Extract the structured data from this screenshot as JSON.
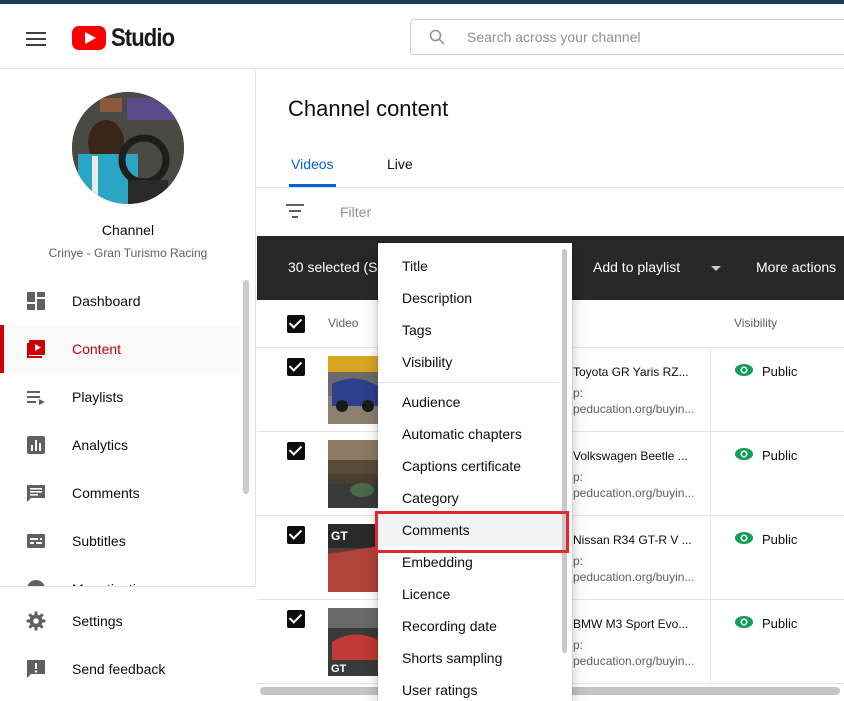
{
  "header": {
    "app_name": "Studio",
    "search_placeholder": "Search across your channel"
  },
  "sidebar": {
    "channel_title": "Channel",
    "channel_name": "Crinye - Gran Turismo Racing",
    "items": [
      {
        "label": "Dashboard",
        "icon": "dashboard-icon"
      },
      {
        "label": "Content",
        "icon": "content-icon",
        "active": true
      },
      {
        "label": "Playlists",
        "icon": "playlists-icon"
      },
      {
        "label": "Analytics",
        "icon": "analytics-icon"
      },
      {
        "label": "Comments",
        "icon": "comments-icon"
      },
      {
        "label": "Subtitles",
        "icon": "subtitles-icon"
      },
      {
        "label": "Monetisation",
        "icon": "monetisation-icon"
      }
    ],
    "bottom": [
      {
        "label": "Settings",
        "icon": "gear-icon"
      },
      {
        "label": "Send feedback",
        "icon": "feedback-icon"
      }
    ]
  },
  "main": {
    "title": "Channel content",
    "tabs": [
      {
        "label": "Videos",
        "active": true
      },
      {
        "label": "Live"
      }
    ],
    "filter_placeholder": "Filter",
    "selection_bar": {
      "selected": "30 selected (S",
      "add_to_playlist": "Add to playlist",
      "more_actions": "More actions"
    },
    "columns": {
      "video": "Video",
      "visibility": "Visibility"
    },
    "rows": [
      {
        "title": "Toyota GR Yaris RZ...",
        "desc1": "p:",
        "desc2": "peducation.org/buyin...",
        "visibility": "Public"
      },
      {
        "title": "Volkswagen Beetle ...",
        "desc1": "p:",
        "desc2": "peducation.org/buyin...",
        "visibility": "Public"
      },
      {
        "title": "Nissan R34 GT-R V ...",
        "desc1": "p:",
        "desc2": "peducation.org/buyin...",
        "visibility": "Public"
      },
      {
        "title": "BMW M3 Sport Evo...",
        "desc1": "p:",
        "desc2": "peducation.org/buyin...",
        "visibility": "Public"
      }
    ]
  },
  "dropdown": {
    "items": [
      "Title",
      "Description",
      "Tags",
      "Visibility",
      "Audience",
      "Automatic chapters",
      "Captions certificate",
      "Category",
      "Comments",
      "Embedding",
      "Licence",
      "Recording date",
      "Shorts sampling",
      "User ratings"
    ],
    "highlighted": "Comments"
  },
  "colors": {
    "accent": "#065fd4",
    "active": "#cc0000",
    "public": "#0f9d58",
    "highlight_box": "#e0282e"
  }
}
